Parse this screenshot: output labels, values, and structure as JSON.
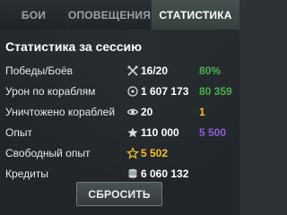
{
  "tabs": [
    {
      "label": "БОИ",
      "active": false
    },
    {
      "label": "ОПОВЕЩЕНИЯ",
      "active": false
    },
    {
      "label": "СТАТИСТИКА",
      "active": true
    }
  ],
  "panel": {
    "title": "Статистика за сессию",
    "rows": [
      {
        "label": "Победы/Боёв",
        "icon": "crossed-swords-icon",
        "value": "16/20",
        "extra": "80%",
        "extra_color": "#4caf50"
      },
      {
        "label": "Урон по кораблям",
        "icon": "target-icon",
        "value": "1 607 173",
        "extra": "80 359",
        "extra_color": "#4caf50"
      },
      {
        "label": "Уничтожено кораблей",
        "icon": "destroyed-ship-icon",
        "value": "20",
        "extra": "1",
        "extra_color": "#f2c12e"
      },
      {
        "label": "Опыт",
        "icon": "experience-star-icon",
        "value": "110 000",
        "extra": "5 500",
        "extra_color": "#8e5cd6"
      },
      {
        "label": "Свободный опыт",
        "icon": "free-xp-star-icon",
        "value": "5 502",
        "value_color": "#f2c12e",
        "extra": "",
        "extra_color": "#ffffff"
      },
      {
        "label": "Кредиты",
        "icon": "credits-coin-icon",
        "value": "6 060 132",
        "extra": "",
        "extra_color": "#ffffff"
      }
    ]
  },
  "reset_button": {
    "label": "СБРОСИТЬ"
  }
}
